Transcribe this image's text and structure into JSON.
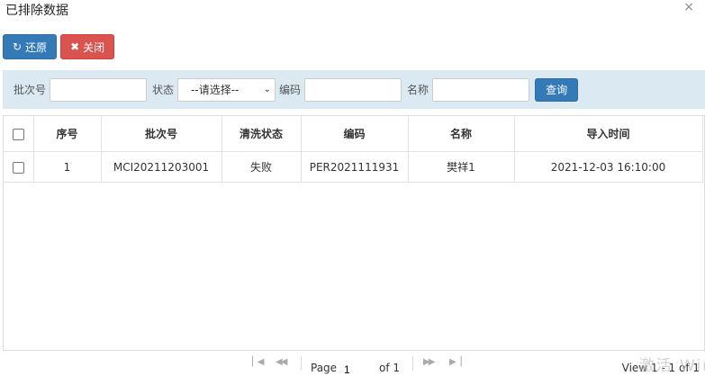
{
  "dialog": {
    "title": "已排除数据",
    "close_label": "×"
  },
  "toolbar": {
    "restore_label": "还原",
    "close_label": "关闭"
  },
  "filters": {
    "batch_label": "批次号",
    "batch_value": "",
    "status_label": "状态",
    "status_selected": "--请选择--",
    "code_label": "编码",
    "code_value": "",
    "name_label": "名称",
    "name_value": "",
    "query_label": "查询"
  },
  "table": {
    "columns": [
      "序号",
      "批次号",
      "清洗状态",
      "编码",
      "名称",
      "导入时间"
    ],
    "rows": [
      {
        "seq": "1",
        "batch": "MCI20211203001",
        "status": "失败",
        "code": "PER2021111931",
        "name": "樊祥1",
        "import_time": "2021-12-03 16:10:00"
      }
    ]
  },
  "pager": {
    "page_label": "Page",
    "page_value": "1",
    "of_label": "of 1",
    "view_label": "View 1 - 1 of 1"
  },
  "watermark": "激活 Win"
}
